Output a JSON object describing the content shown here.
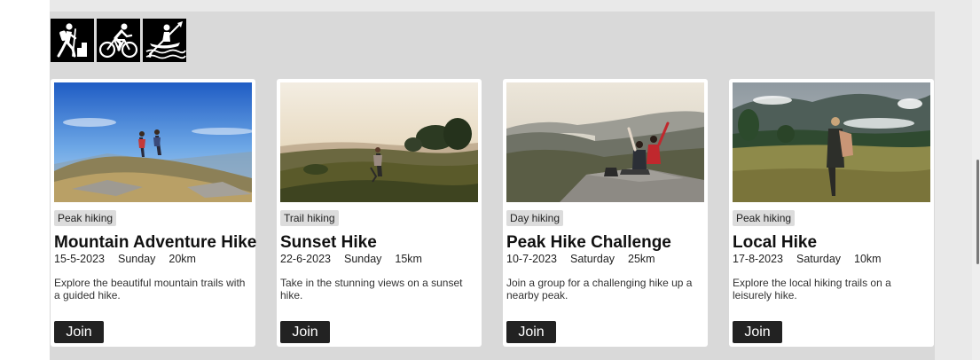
{
  "activities": [
    {
      "icon": "hiking-icon"
    },
    {
      "icon": "cycling-icon"
    },
    {
      "icon": "kayaking-icon"
    }
  ],
  "cards": [
    {
      "tag": "Peak hiking",
      "title": "Mountain Adventure Hike",
      "date": "15-5-2023",
      "day": "Sunday",
      "distance": "20km",
      "description": "Explore the beautiful mountain trails with a guided hike.",
      "join_label": "Join"
    },
    {
      "tag": "Trail hiking",
      "title": "Sunset Hike",
      "date": "22-6-2023",
      "day": "Sunday",
      "distance": "15km",
      "description": "Take in the stunning views on a sunset hike.",
      "join_label": "Join"
    },
    {
      "tag": "Day hiking",
      "title": "Peak Hike Challenge",
      "date": "10-7-2023",
      "day": "Saturday",
      "distance": "25km",
      "description": "Join a group for a challenging hike up a nearby peak.",
      "join_label": "Join"
    },
    {
      "tag": "Peak hiking",
      "title": "Local Hike",
      "date": "17-8-2023",
      "day": "Saturday",
      "distance": "10km",
      "description": "Explore the local hiking trails on a leisurely hike.",
      "join_label": "Join"
    }
  ],
  "colors": {
    "panel": "#d9d9d9",
    "band": "#e9e9e9",
    "card": "#ffffff",
    "tag": "#dcdcdc",
    "button": "#222222"
  }
}
